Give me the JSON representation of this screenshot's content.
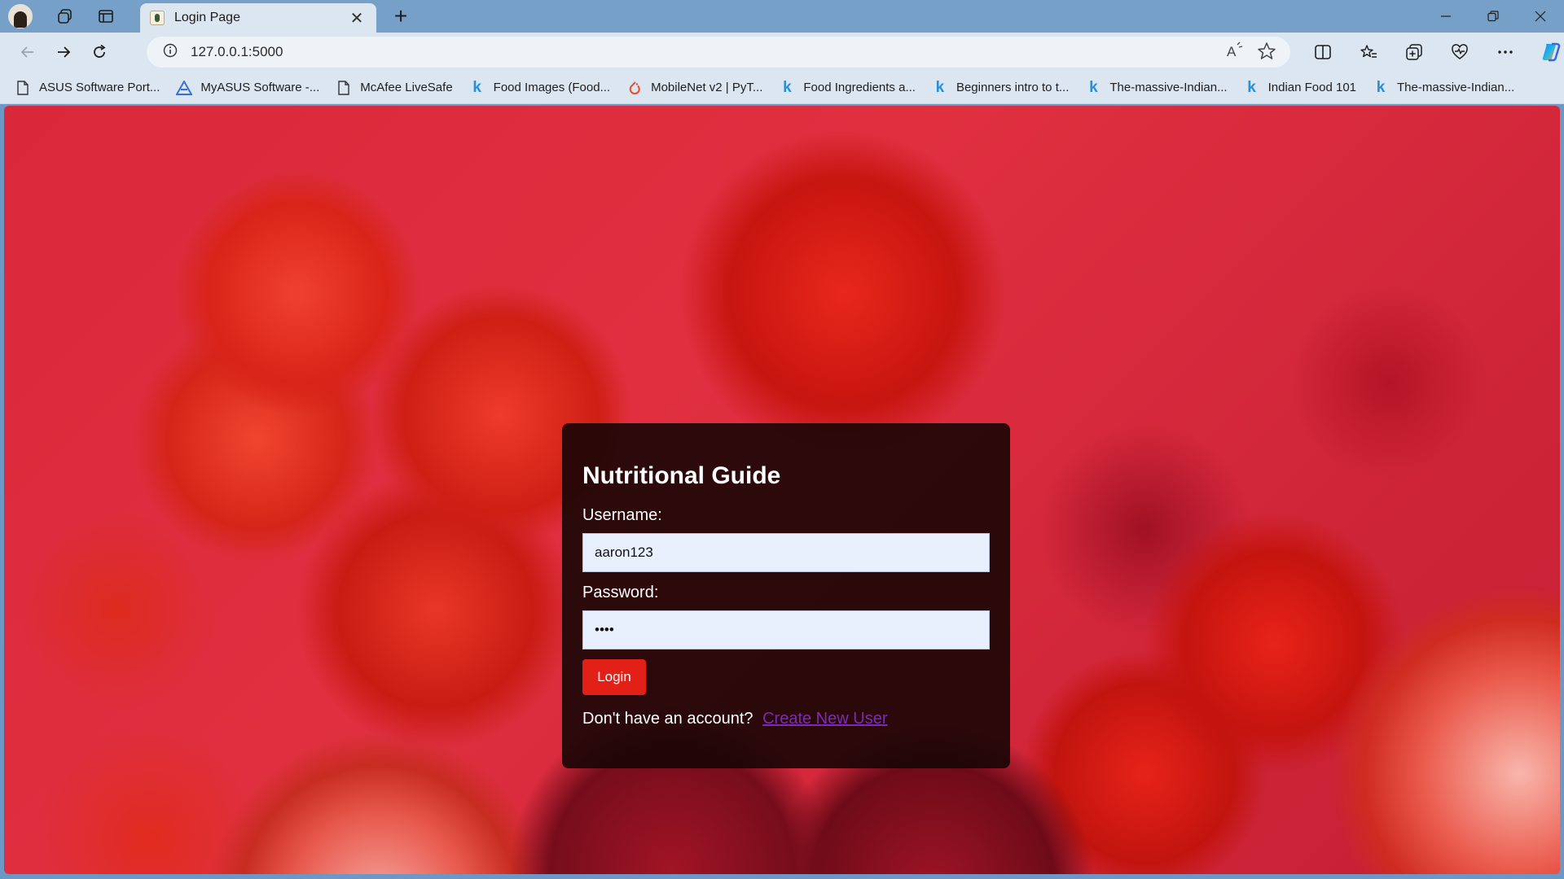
{
  "browser": {
    "tab_title": "Login Page",
    "url": "127.0.0.1:5000"
  },
  "bookmarks": [
    {
      "label": "ASUS Software Port...",
      "icon": "document-icon"
    },
    {
      "label": "MyASUS Software -...",
      "icon": "asus-logo-icon"
    },
    {
      "label": "McAfee LiveSafe",
      "icon": "document-icon"
    },
    {
      "label": "Food Images (Food...",
      "icon": "kaggle-icon"
    },
    {
      "label": "MobileNet v2 | PyT...",
      "icon": "pytorch-icon"
    },
    {
      "label": "Food Ingredients a...",
      "icon": "kaggle-icon"
    },
    {
      "label": "Beginners intro to t...",
      "icon": "kaggle-icon"
    },
    {
      "label": "The-massive-Indian...",
      "icon": "kaggle-icon"
    },
    {
      "label": "Indian Food 101",
      "icon": "kaggle-icon"
    },
    {
      "label": "The-massive-Indian...",
      "icon": "kaggle-icon"
    }
  ],
  "login": {
    "title": "Nutritional Guide",
    "username_label": "Username:",
    "username_value": "aaron123",
    "password_label": "Password:",
    "password_value": "••••",
    "login_button": "Login",
    "signup_prompt": "Don't have an account?",
    "signup_link": "Create New User"
  },
  "colors": {
    "accent_button": "#e22018",
    "link": "#7b2bb6",
    "card_background": "#180606"
  }
}
